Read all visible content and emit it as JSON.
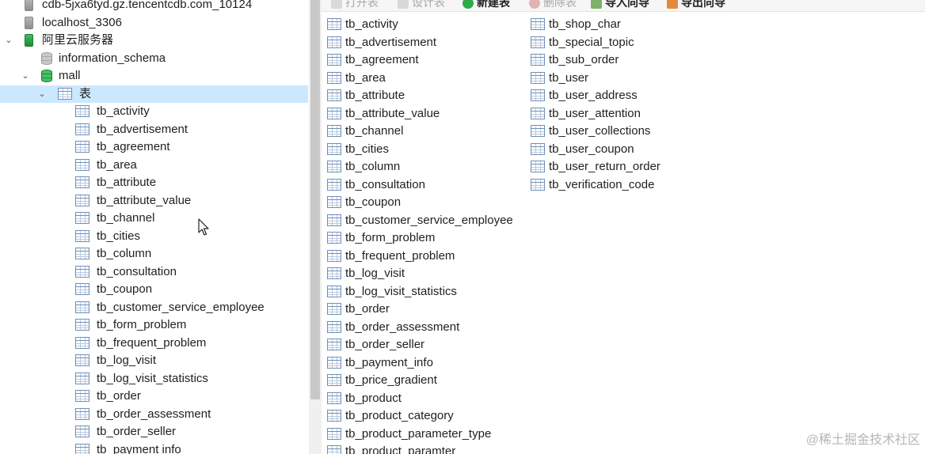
{
  "tree": {
    "connections": [
      {
        "label": "cdb-5jxa6tyd.gz.tencentcdb.com_10124",
        "icon": "server-gray"
      },
      {
        "label": "localhost_3306",
        "icon": "server-gray"
      },
      {
        "label": "阿里云服务器",
        "icon": "server-green",
        "expanded": true
      }
    ],
    "databases": [
      {
        "label": "information_schema",
        "icon": "database-gray"
      },
      {
        "label": "mall",
        "icon": "database-green",
        "expanded": true
      }
    ],
    "tables_node": {
      "label": "表",
      "selected": true
    },
    "tables": [
      "tb_activity",
      "tb_advertisement",
      "tb_agreement",
      "tb_area",
      "tb_attribute",
      "tb_attribute_value",
      "tb_channel",
      "tb_cities",
      "tb_column",
      "tb_consultation",
      "tb_coupon",
      "tb_customer_service_employee",
      "tb_form_problem",
      "tb_frequent_problem",
      "tb_log_visit",
      "tb_log_visit_statistics",
      "tb_order",
      "tb_order_assessment",
      "tb_order_seller",
      "tb_payment info"
    ]
  },
  "toolbar": {
    "buttons": [
      {
        "label": "打开表",
        "state": "disabled",
        "icon": "open-table-icon"
      },
      {
        "label": "设计表",
        "state": "disabled",
        "icon": "design-table-icon"
      },
      {
        "label": "新建表",
        "state": "enabled",
        "icon": "new-table-icon"
      },
      {
        "label": "删除表",
        "state": "disabled",
        "icon": "delete-table-icon"
      },
      {
        "label": "导入向导",
        "state": "enabled",
        "icon": "import-wizard-icon"
      },
      {
        "label": "导出向导",
        "state": "enabled",
        "icon": "export-wizard-icon"
      }
    ]
  },
  "objects": {
    "column1": [
      "tb_activity",
      "tb_advertisement",
      "tb_agreement",
      "tb_area",
      "tb_attribute",
      "tb_attribute_value",
      "tb_channel",
      "tb_cities",
      "tb_column",
      "tb_consultation",
      "tb_coupon",
      "tb_customer_service_employee",
      "tb_form_problem",
      "tb_frequent_problem",
      "tb_log_visit",
      "tb_log_visit_statistics",
      "tb_order",
      "tb_order_assessment",
      "tb_order_seller",
      "tb_payment_info",
      "tb_price_gradient",
      "tb_product",
      "tb_product_category",
      "tb_product_parameter_type",
      "tb_product_paramter"
    ],
    "column2": [
      "tb_shop_char",
      "tb_special_topic",
      "tb_sub_order",
      "tb_user",
      "tb_user_address",
      "tb_user_attention",
      "tb_user_collections",
      "tb_user_coupon",
      "tb_user_return_order",
      "tb_verification_code"
    ]
  },
  "watermark": "@稀土掘金技术社区",
  "colors": {
    "selection": "#cce8ff",
    "icon_green": "#1e8a37"
  }
}
